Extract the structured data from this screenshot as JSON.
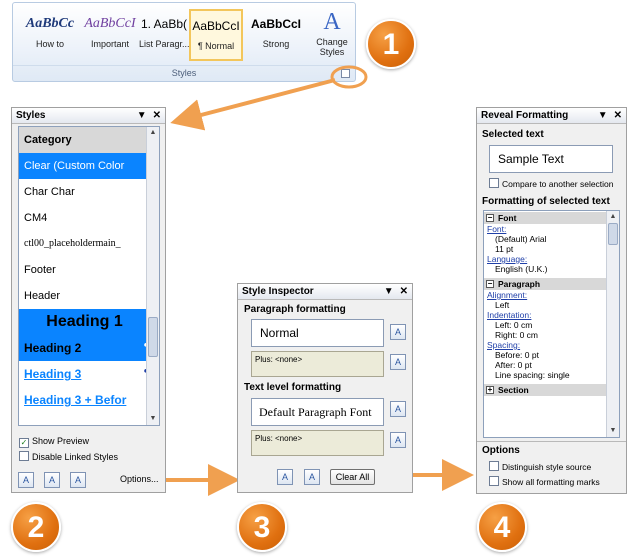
{
  "ribbon": {
    "group_label": "Styles",
    "swatches": [
      {
        "preview": "AaBbCc",
        "label": "How to"
      },
      {
        "preview": "AaBbCcI",
        "label": "Important"
      },
      {
        "preview": "1. AaBb(",
        "label": "List Paragr..."
      },
      {
        "preview": "AaBbCcI",
        "label": "¶ Normal"
      },
      {
        "preview": "AaBbCcI",
        "label": "Strong"
      }
    ],
    "change_styles": "Change Styles",
    "change_styles_glyph": "A"
  },
  "badges": [
    "1",
    "2",
    "3",
    "4"
  ],
  "styles_pane": {
    "title": "Styles",
    "items": [
      {
        "label": "Category",
        "mark": "¶"
      },
      {
        "label": "Clear (Custom Color",
        "mark": ""
      },
      {
        "label": "Char Char",
        "mark": "¶"
      },
      {
        "label": "CM4",
        "mark": "¶"
      },
      {
        "label": "ctl00_placeholdermain_",
        "mark": "a"
      },
      {
        "label": "Footer",
        "mark": "¶"
      },
      {
        "label": "Header",
        "mark": "¶"
      },
      {
        "label": "Heading 1",
        "mark": "¶"
      },
      {
        "label": "Heading 2",
        "mark": "¶a"
      },
      {
        "label": "Heading 3",
        "mark": "¶a"
      },
      {
        "label": "Heading 3 + Befor",
        "mark": ""
      }
    ],
    "show_preview": "Show Preview",
    "disable_linked": "Disable Linked Styles",
    "options": "Options..."
  },
  "style_inspector": {
    "title": "Style Inspector",
    "para_heading": "Paragraph formatting",
    "para_style": "Normal",
    "para_plus": "Plus: <none>",
    "text_heading": "Text level formatting",
    "text_style": "Default Paragraph Font",
    "text_plus": "Plus: <none>",
    "clear_all": "Clear All"
  },
  "reveal": {
    "title": "Reveal Formatting",
    "selected_text_heading": "Selected text",
    "sample": "Sample Text",
    "compare": "Compare to another selection",
    "formatting_heading": "Formatting of selected text",
    "font_head": "Font",
    "font_link": "Font:",
    "font_val1": "(Default) Arial",
    "font_val2": "11 pt",
    "lang_link": "Language:",
    "lang_val": "English (U.K.)",
    "para_head": "Paragraph",
    "align_link": "Alignment:",
    "align_val": "Left",
    "indent_link": "Indentation:",
    "indent_left": "Left:  0 cm",
    "indent_right": "Right:  0 cm",
    "spacing_link": "Spacing:",
    "before": "Before:  0 pt",
    "after": "After:  0 pt",
    "line_spacing": "Line spacing:  single",
    "section_head": "Section",
    "options_heading": "Options",
    "distinguish": "Distinguish style source",
    "show_marks": "Show all formatting marks"
  },
  "colors": {
    "arrow": "#f0a050",
    "badge": "#e07010",
    "highlight": "#0a84ff"
  }
}
